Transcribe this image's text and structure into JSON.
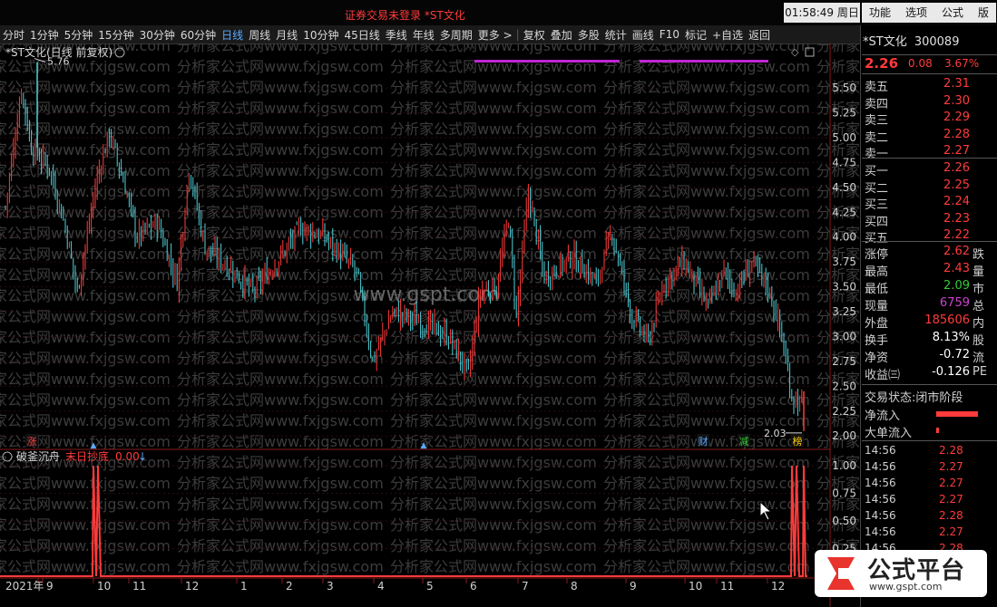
{
  "window": {
    "title": "证券交易未登录  *ST文化",
    "clock": "01:58:49 周日"
  },
  "menu": [
    "功能",
    "选项",
    "公式",
    "版"
  ],
  "toolbar": [
    "分时",
    "1分钟",
    "5分钟",
    "15分钟",
    "30分钟",
    "60分钟",
    "日线",
    "周线",
    "月线",
    "10分钟",
    "45日线",
    "季线",
    "年线",
    "多周期",
    "更多 >",
    "复权",
    "叠加",
    "多股",
    "统计",
    "画线",
    "F10",
    "标记",
    "+自选",
    "返回"
  ],
  "toolbar_active": "日线",
  "chart_header": "*ST文化(日线 前复权)",
  "watermark": {
    "text": "分析家公式网www.fxjgsw.com",
    "center": "www.gspt.com"
  },
  "price_axis": [
    "5.50",
    "5.25",
    "5.00",
    "4.75",
    "4.50",
    "4.25",
    "4.00",
    "3.75",
    "3.50",
    "3.25",
    "3.00",
    "2.75",
    "2.50",
    "2.25",
    "2.00"
  ],
  "annotations": {
    "high": "5.76",
    "low": "2.03"
  },
  "markers": [
    {
      "label": "涨",
      "color": "#ff4040"
    },
    {
      "label": "财",
      "color": "#5aa9ff"
    },
    {
      "label": "减",
      "color": "#33cc33"
    },
    {
      "label": "榜",
      "color": "#ffcc00"
    }
  ],
  "indicator": {
    "name": "破釜沉舟",
    "line_name": "末日抄底",
    "value": "0.00",
    "axis": [
      "1.00",
      "0.75",
      "0.50",
      "0.25"
    ]
  },
  "x_axis": [
    "2021年",
    "9",
    "10",
    "11",
    "12",
    "1",
    "2",
    "3",
    "4",
    "5",
    "6",
    "7",
    "8",
    "9",
    "10",
    "11",
    "12"
  ],
  "quote": {
    "name": "*ST文化",
    "code": "300089",
    "price": "2.26",
    "change": "0.08",
    "pct": "3.67%",
    "asks": [
      {
        "l": "卖五",
        "v": "2.31"
      },
      {
        "l": "卖四",
        "v": "2.30"
      },
      {
        "l": "卖三",
        "v": "2.29"
      },
      {
        "l": "卖二",
        "v": "2.28"
      },
      {
        "l": "卖一",
        "v": "2.27"
      }
    ],
    "bids": [
      {
        "l": "买一",
        "v": "2.26"
      },
      {
        "l": "买二",
        "v": "2.25"
      },
      {
        "l": "买三",
        "v": "2.24"
      },
      {
        "l": "买四",
        "v": "2.23"
      },
      {
        "l": "买五",
        "v": "2.22"
      }
    ],
    "stats": [
      {
        "l": "涨停",
        "v": "2.62",
        "e": "跌",
        "c": "#ff3b3b"
      },
      {
        "l": "最高",
        "v": "2.43",
        "e": "量",
        "c": "#ff3b3b"
      },
      {
        "l": "最低",
        "v": "2.09",
        "e": "市",
        "c": "#33cc33"
      },
      {
        "l": "现量",
        "v": "6759",
        "e": "总",
        "c": "#cc44cc"
      },
      {
        "l": "外盘",
        "v": "185606",
        "e": "内",
        "c": "#ff3b3b"
      },
      {
        "l": "换手",
        "v": "8.13%",
        "e": "股",
        "c": "#ffffff"
      },
      {
        "l": "净资",
        "v": "-0.72",
        "e": "流",
        "c": "#ffffff"
      },
      {
        "l": "收益㈢",
        "v": "-0.126",
        "e": "PE",
        "c": "#ffffff"
      }
    ],
    "state_label": "交易状态:",
    "state": "闭市阶段",
    "net_inflow": "净流入",
    "big_inflow": "大单流入",
    "ticks": [
      {
        "t": "14:56",
        "p": "2.28"
      },
      {
        "t": "14:56",
        "p": "2.27"
      },
      {
        "t": "14:56",
        "p": "2.27"
      },
      {
        "t": "14:56",
        "p": "2.27"
      },
      {
        "t": "14:56",
        "p": "2.28"
      },
      {
        "t": "14:56",
        "p": "2.27"
      },
      {
        "t": "14:56",
        "p": "2.28"
      }
    ]
  },
  "logo": {
    "text": "公式平台",
    "url": "www.gspt.com"
  },
  "colors": {
    "up": "#ff3b3b",
    "down": "#4fd1d9",
    "accent": "#5aa9ff",
    "grid": "#3a1010"
  }
}
